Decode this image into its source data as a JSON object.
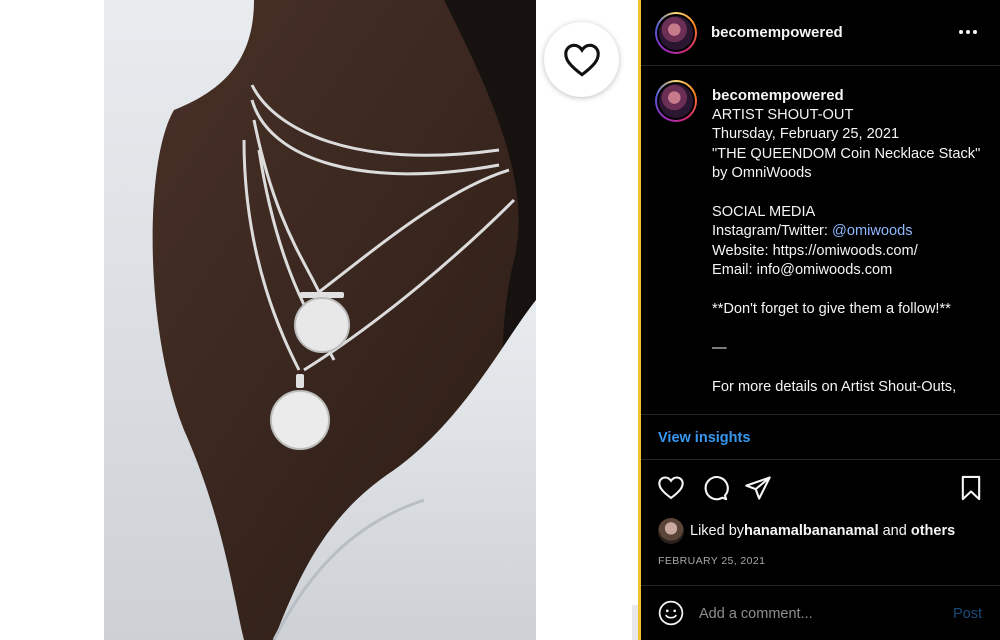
{
  "post": {
    "username": "becomempowered",
    "caption_lines": [
      "ARTIST SHOUT-OUT",
      "Thursday, February 25, 2021",
      "\"THE QUEENDOM Coin Necklace Stack\"",
      "by OmniWoods",
      "",
      "SOCIAL MEDIA"
    ],
    "social_prefix": "Instagram/Twitter: ",
    "social_handle": "@omiwoods",
    "website_line": "Website: https://omiwoods.com/",
    "email_line": "Email: info@omiwoods.com",
    "follow_line": "**Don't forget to give them a follow!**",
    "dash_line": "—",
    "more_line": "For more details on Artist Shout-Outs,",
    "view_insights": "View insights",
    "liked_prefix": "Liked by ",
    "liked_user": "hanamalbananamal",
    "liked_and": " and ",
    "liked_others": "others",
    "date": "FEBRUARY 25, 2021",
    "comment_placeholder": "Add a comment...",
    "post_label": "Post"
  },
  "icons": {
    "like_overlay": "heart-icon",
    "more": "more-horizontal-icon",
    "like": "heart-outline-icon",
    "comment": "comment-icon",
    "share": "paper-plane-icon",
    "save": "bookmark-icon",
    "emoji": "smiley-icon"
  },
  "colors": {
    "panel_bg": "#000000",
    "link_blue": "#3897f0",
    "post_disabled": "#1d4c7a",
    "divider": "#262626"
  }
}
